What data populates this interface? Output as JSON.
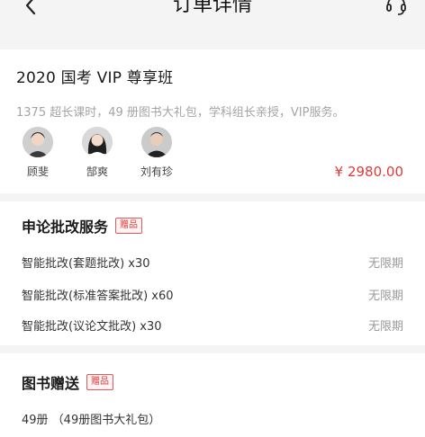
{
  "header": {
    "title": "订单详情",
    "back_icon": "chevron-left-icon",
    "service_icon": "headset-icon"
  },
  "course": {
    "title": "2020 国考 VIP 尊享班",
    "description": "1375 超长课时，49 册图书大礼包，学科组长亲授，VIP服务。",
    "teachers": [
      {
        "name": "顾斐"
      },
      {
        "name": "郜爽"
      },
      {
        "name": "刘有珍"
      }
    ],
    "price": "¥ 2980.00"
  },
  "essay_service": {
    "title": "申论批改服务",
    "badge": "赠品",
    "items": [
      {
        "name": "智能批改(套题批改) x30",
        "period": "无限期"
      },
      {
        "name": "智能批改(标准答案批改) x60",
        "period": "无限期"
      },
      {
        "name": "智能批改(议论文批改) x30",
        "period": "无限期"
      }
    ]
  },
  "books": {
    "title": "图书赠送",
    "badge": "赠品",
    "item": "49册 （49册图书大礼包）"
  },
  "colors": {
    "accent": "#e03a3a",
    "background": "#f4f4f4",
    "muted": "#a4a4a4"
  }
}
